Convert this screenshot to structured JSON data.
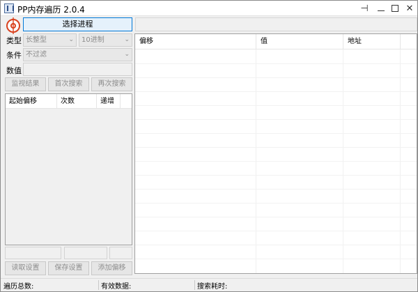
{
  "window": {
    "title": "PP内存遍历 2.0.4"
  },
  "toolbar": {
    "select_process_label": "选择进程",
    "process_value": ""
  },
  "filters": {
    "type_label": "类型",
    "type_value": "长整型",
    "base_value": "10进制",
    "condition_label": "条件",
    "condition_value": "不过滤",
    "value_label": "数值",
    "value_input": ""
  },
  "search_buttons": {
    "monitor_label": "监视结果",
    "first_search_label": "首次搜索",
    "next_search_label": "再次搜索"
  },
  "left_list": {
    "columns": [
      "起始偏移",
      "次数",
      "递增"
    ]
  },
  "bottom_buttons": {
    "read_settings_label": "读取设置",
    "save_settings_label": "保存设置",
    "add_offset_label": "添加偏移"
  },
  "main_table": {
    "columns": [
      "偏移",
      "值",
      "地址"
    ]
  },
  "status": {
    "total_label": "遍历总数:",
    "valid_label": "有效数据:",
    "time_label": "搜索耗时:"
  }
}
